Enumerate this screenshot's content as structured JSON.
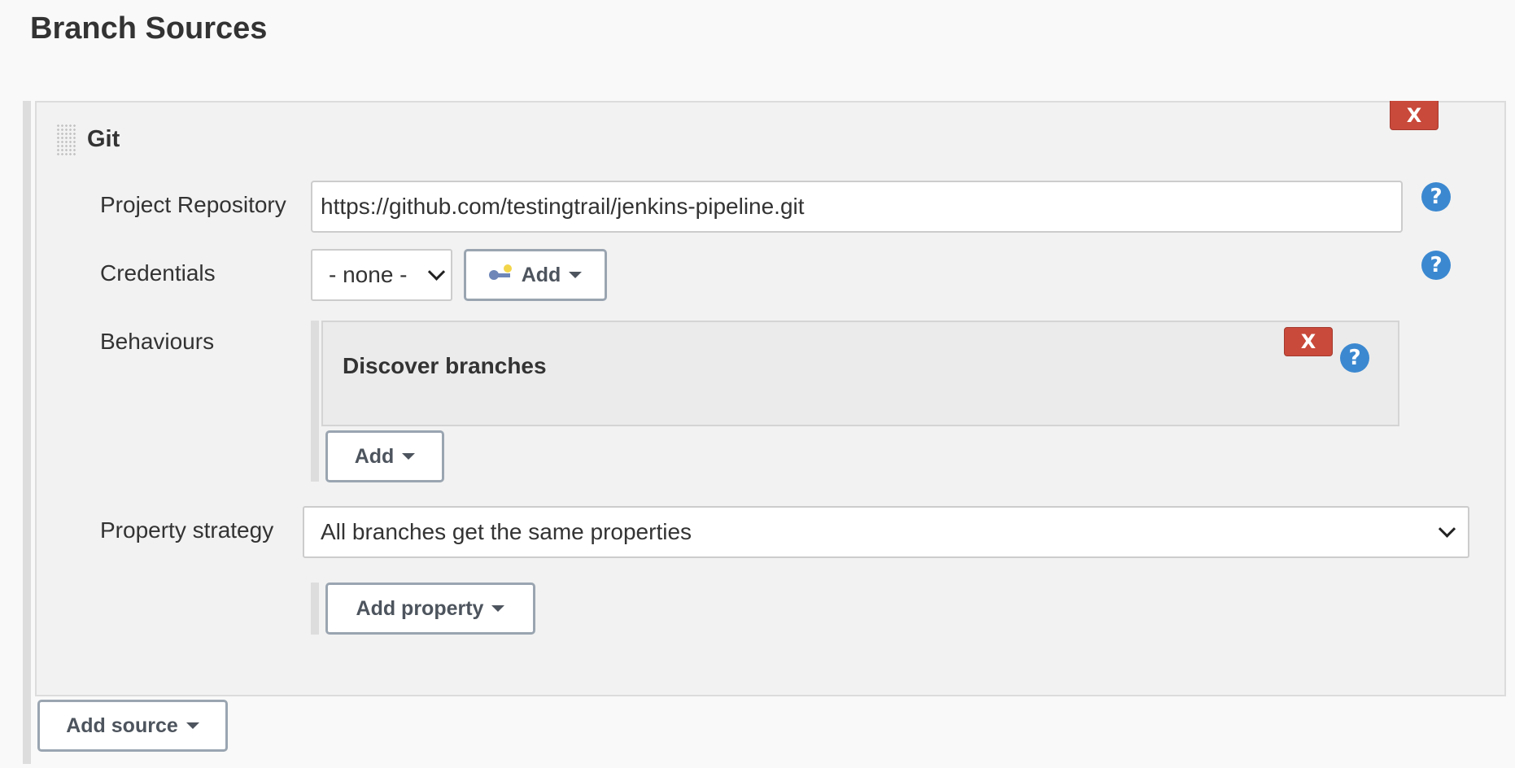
{
  "page": {
    "title": "Branch Sources"
  },
  "git_source": {
    "title": "Git",
    "delete_label": "X",
    "project_repository": {
      "label": "Project Repository",
      "value": "https://github.com/testingtrail/jenkins-pipeline.git"
    },
    "credentials": {
      "label": "Credentials",
      "selected": "- none -",
      "add_label": "Add"
    },
    "behaviours": {
      "label": "Behaviours",
      "items": [
        {
          "title": "Discover branches",
          "delete_label": "X"
        }
      ],
      "add_label": "Add"
    },
    "property_strategy": {
      "label": "Property strategy",
      "selected": "All branches get the same properties",
      "add_property_label": "Add property"
    },
    "help_label": "?"
  },
  "footer": {
    "add_source_label": "Add source"
  },
  "colors": {
    "delete": "#c9493a",
    "help": "#3b88d0",
    "button_border": "#9aa5b1"
  },
  "icons": {
    "drag": "drag-handle-icon",
    "help": "help-icon",
    "key": "key-icon",
    "caret": "caret-down-icon",
    "chevron": "chevron-down-icon"
  }
}
